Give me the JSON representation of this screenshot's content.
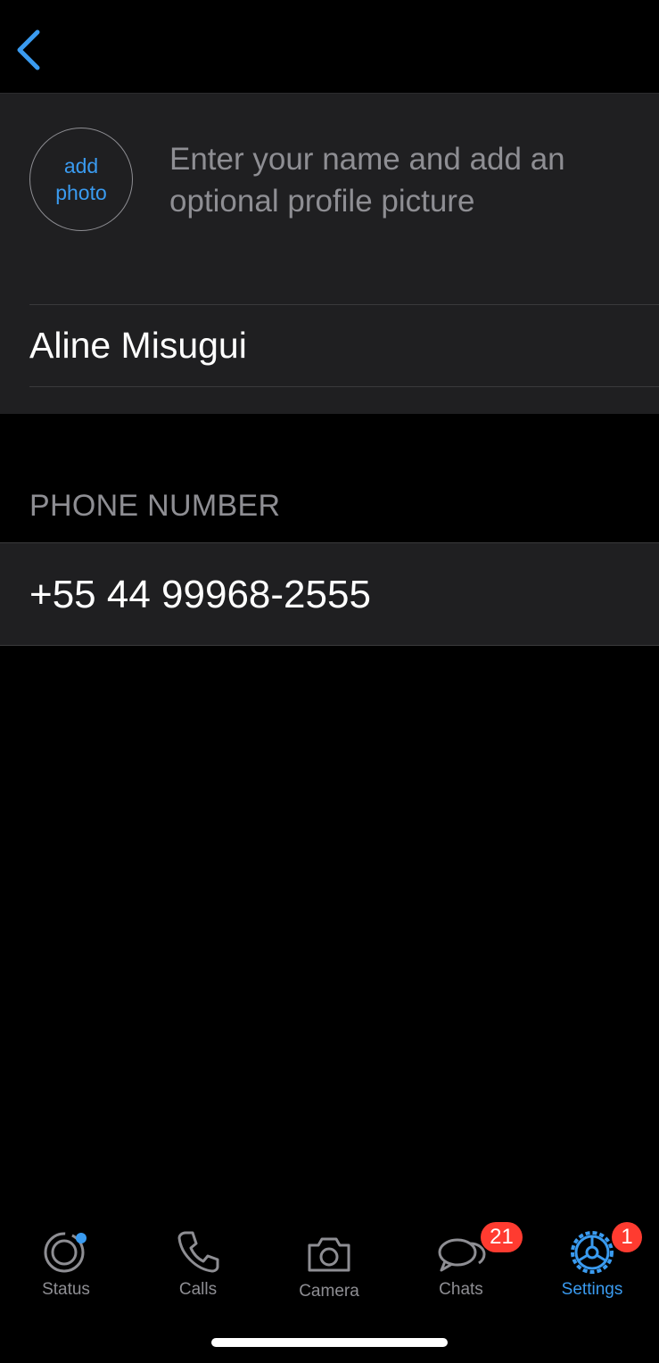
{
  "header": {
    "back_icon": "chevron-left-icon"
  },
  "profile": {
    "add_photo_label": "add photo",
    "hint": "Enter your name and add an optional profile picture",
    "name_value": "Aline Misugui"
  },
  "phone": {
    "header": "PHONE NUMBER",
    "value": "+55 44 99968-2555"
  },
  "tabbar": {
    "tabs": [
      {
        "label": "Status",
        "icon": "status-icon"
      },
      {
        "label": "Calls",
        "icon": "phone-icon"
      },
      {
        "label": "Camera",
        "icon": "camera-icon"
      },
      {
        "label": "Chats",
        "icon": "chats-icon",
        "badge": "21"
      },
      {
        "label": "Settings",
        "icon": "gear-icon",
        "badge": "1"
      }
    ],
    "active": "Settings"
  },
  "colors": {
    "accent": "#3a9bf0",
    "background": "#000000",
    "section": "#1f1f21",
    "badge": "#ff3b30",
    "secondary_text": "#8e8e93"
  }
}
